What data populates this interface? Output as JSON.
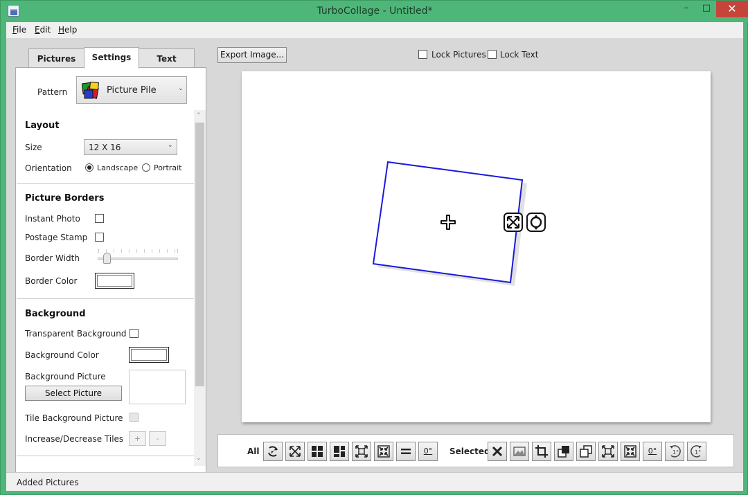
{
  "window": {
    "title": "TurboCollage - Untitled*",
    "minimize_glyph": "–",
    "maximize_glyph": "□",
    "close_glyph": "✕"
  },
  "menu": [
    {
      "label": "File",
      "mnemonic": "F",
      "rest": "ile"
    },
    {
      "label": "Edit",
      "mnemonic": "E",
      "rest": "dit"
    },
    {
      "label": "Help",
      "mnemonic": "H",
      "rest": "elp"
    }
  ],
  "tabs": [
    "Pictures",
    "Settings",
    "Text"
  ],
  "active_tab": "Settings",
  "settings": {
    "pattern": {
      "label": "Pattern",
      "value": "Picture Pile",
      "icon": "picture-pile-icon"
    },
    "layout": {
      "heading": "Layout",
      "size_label": "Size",
      "size_value": "12 X 16",
      "orientation_label": "Orientation",
      "orientation_options": [
        "Landscape",
        "Portrait"
      ],
      "orientation_selected": "Landscape"
    },
    "borders": {
      "heading": "Picture Borders",
      "instant_photo": "Instant Photo",
      "instant_photo_checked": false,
      "postage_stamp": "Postage Stamp",
      "postage_stamp_checked": false,
      "border_width": "Border Width",
      "border_width_value": 0.08,
      "border_color": "Border Color",
      "border_color_value": "#ffffff"
    },
    "background": {
      "heading": "Background",
      "transparent": "Transparent Background",
      "transparent_checked": false,
      "color_label": "Background Color",
      "color_value": "#ffffff",
      "picture_label": "Background Picture",
      "select_button": "Select Picture",
      "tile_label": "Tile Background Picture",
      "tile_checked": false,
      "tile_enabled": false,
      "tiles_label": "Increase/Decrease Tiles",
      "increase": "+",
      "decrease": "-"
    }
  },
  "top_controls": {
    "export": "Export Image...",
    "lock_pictures": "Lock Pictures",
    "lock_text": "Lock Text"
  },
  "bottom_toolbar": {
    "all_label": "All",
    "all_buttons": [
      "rotate-all-icon",
      "fit-all-icon",
      "grid-icon",
      "mosaic-icon",
      "expand-all-icon",
      "shrink-all-icon",
      "equalize-icon",
      "zero-rotation-icon"
    ],
    "all_zero_text": "0°",
    "selected_label": "Selected",
    "selected_buttons": [
      "delete-icon",
      "image-icon",
      "crop-icon",
      "bring-forward-icon",
      "send-backward-icon",
      "fit-selected-icon",
      "shrink-selected-icon",
      "zero-rotation-selected-icon",
      "rotate-right-1-icon",
      "rotate-left-1-icon"
    ],
    "selected_zero_text": "0°",
    "rot_cw_text": "1°",
    "rot_ccw_text": "1°"
  },
  "status": {
    "text": "Added Pictures"
  },
  "colors": {
    "window_frame": "#4fb679",
    "close_button": "#c7443a",
    "selection": "#1a1adb"
  }
}
